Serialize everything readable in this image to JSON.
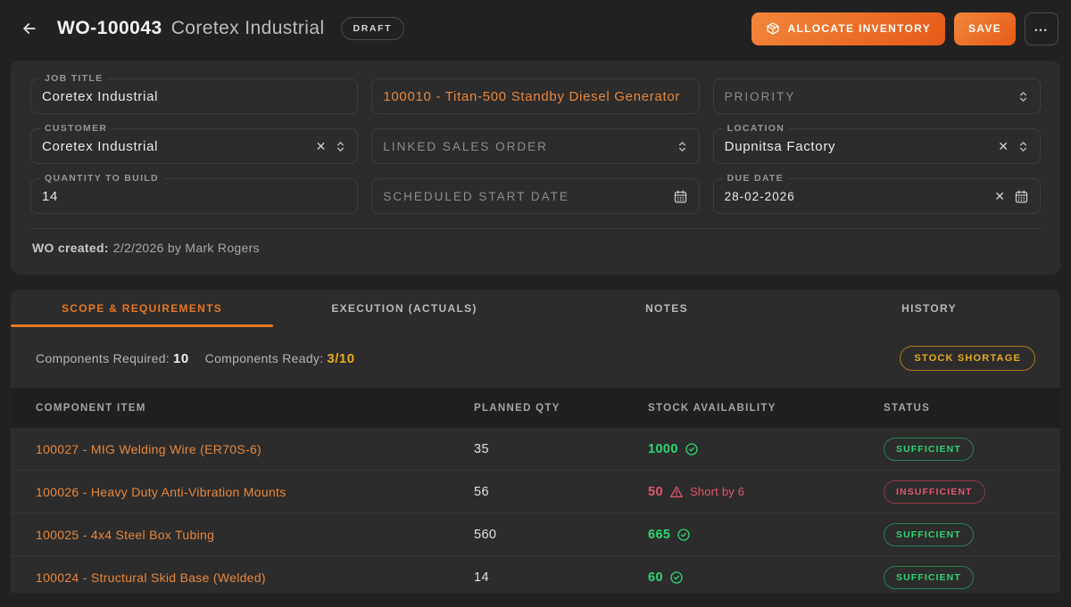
{
  "colors": {
    "accent": "#e87722",
    "green": "#2ed573",
    "red": "#e4566b",
    "amber": "#e8a91d",
    "card": "#2c2c2c"
  },
  "icons": {
    "clear": "✕",
    "more": "•••"
  },
  "header": {
    "wo_number": "WO-100043",
    "wo_name": "Coretex Industrial",
    "status_badge": "DRAFT",
    "allocate_button": "ALLOCATE INVENTORY",
    "save_button": "SAVE"
  },
  "form": {
    "job_title": {
      "label": "JOB TITLE",
      "value": "Coretex Industrial"
    },
    "product": {
      "value": "100010 - Titan-500 Standby Diesel Generator"
    },
    "priority": {
      "placeholder": "PRIORITY"
    },
    "customer": {
      "label": "CUSTOMER",
      "value": "Coretex Industrial"
    },
    "linked_sales_order": {
      "placeholder": "LINKED SALES ORDER"
    },
    "location": {
      "label": "LOCATION",
      "value": "Dupnitsa Factory"
    },
    "quantity": {
      "label": "QUANTITY TO BUILD",
      "value": "14"
    },
    "scheduled_start": {
      "placeholder": "SCHEDULED START DATE"
    },
    "due_date": {
      "label": "DUE DATE",
      "value": "28-02-2026"
    },
    "created_label": "WO created:",
    "created_value": "2/2/2026 by Mark Rogers"
  },
  "tabs": [
    {
      "label": "SCOPE & REQUIREMENTS"
    },
    {
      "label": "EXECUTION (ACTUALS)"
    },
    {
      "label": "NOTES"
    },
    {
      "label": "HISTORY"
    }
  ],
  "summary": {
    "required_label": "Components Required:",
    "required_value": "10",
    "ready_label": "Components Ready:",
    "ready_value": "3/10",
    "shortage_badge": "STOCK SHORTAGE"
  },
  "table": {
    "headers": [
      "COMPONENT ITEM",
      "PLANNED QTY",
      "STOCK AVAILABILITY",
      "STATUS"
    ],
    "rows": [
      {
        "item": "100027 - MIG Welding Wire (ER70S-6)",
        "planned_qty": "35",
        "stock_qty": "1000",
        "stock_state": "ok",
        "stock_note": "",
        "status": "SUFFICIENT"
      },
      {
        "item": "100026 - Heavy Duty Anti-Vibration Mounts",
        "planned_qty": "56",
        "stock_qty": "50",
        "stock_state": "short",
        "stock_note": "Short by 6",
        "status": "INSUFFICIENT"
      },
      {
        "item": "100025 - 4x4 Steel Box Tubing",
        "planned_qty": "560",
        "stock_qty": "665",
        "stock_state": "ok",
        "stock_note": "",
        "status": "SUFFICIENT"
      },
      {
        "item": "100024 - Structural Skid Base (Welded)",
        "planned_qty": "14",
        "stock_qty": "60",
        "stock_state": "ok",
        "stock_note": "",
        "status": "SUFFICIENT"
      }
    ]
  }
}
